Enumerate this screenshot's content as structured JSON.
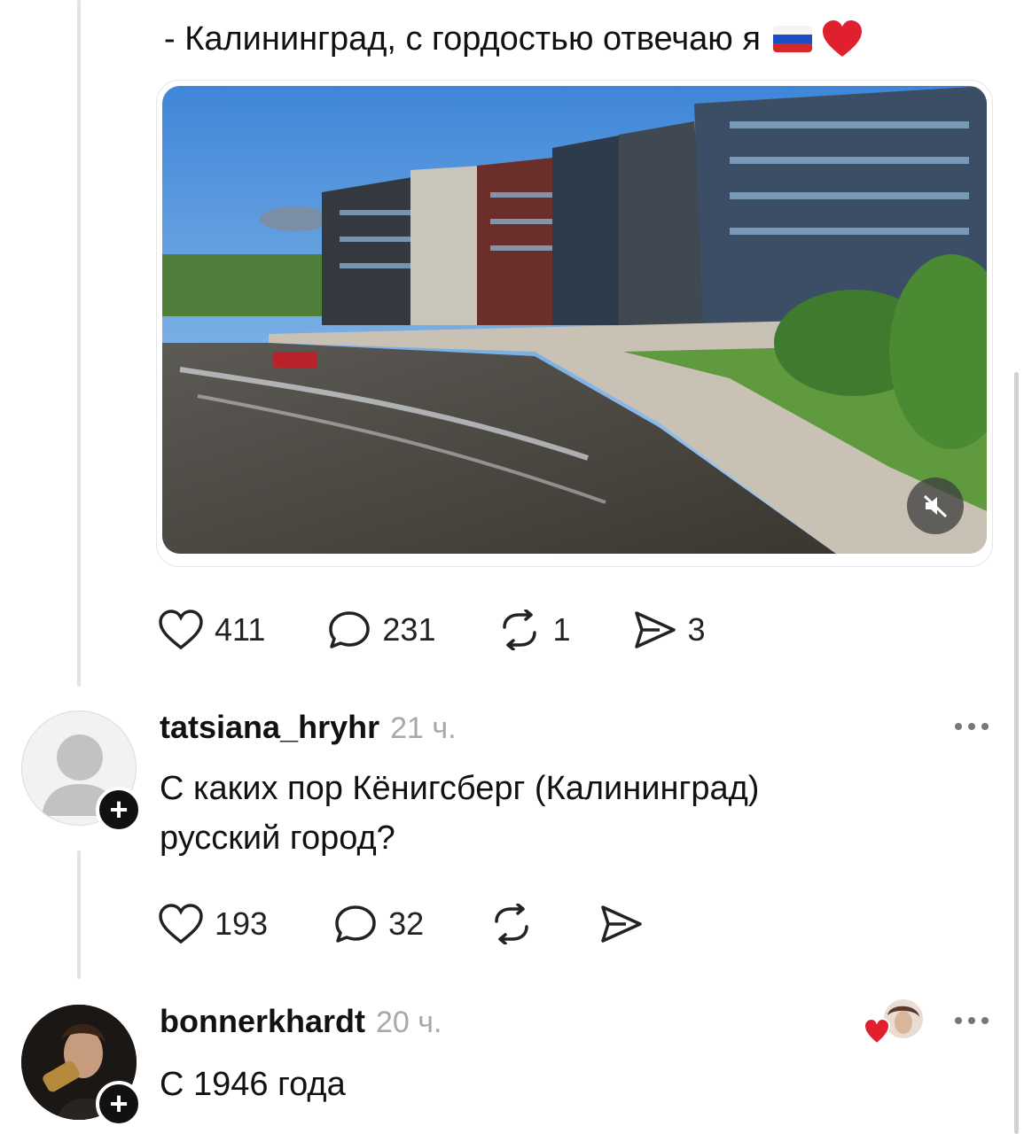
{
  "post": {
    "caption": "- Калининград, с гордостью отвечаю я",
    "caption_emoji_flag": "russia-flag-icon",
    "caption_emoji_heart": "heart-emoji-icon",
    "media_description_icon": "mute-icon",
    "stats": {
      "likes": "411",
      "comments": "231",
      "reposts": "1",
      "shares": "3"
    }
  },
  "comments": [
    {
      "username": "tatsiana_hryhr",
      "time": "21 ч.",
      "text_line1": "С каких пор Кёнигсберг (Калининград)",
      "text_line2": "русский город?",
      "likes": "193",
      "replies": "32"
    },
    {
      "username": "bonnerkhardt",
      "time": "20 ч.",
      "text_line1": "С 1946 года"
    }
  ],
  "colors": {
    "accent_heart": "#e0202e",
    "muted_text": "#a8a8a8",
    "thread_line": "#e3e3e3"
  }
}
